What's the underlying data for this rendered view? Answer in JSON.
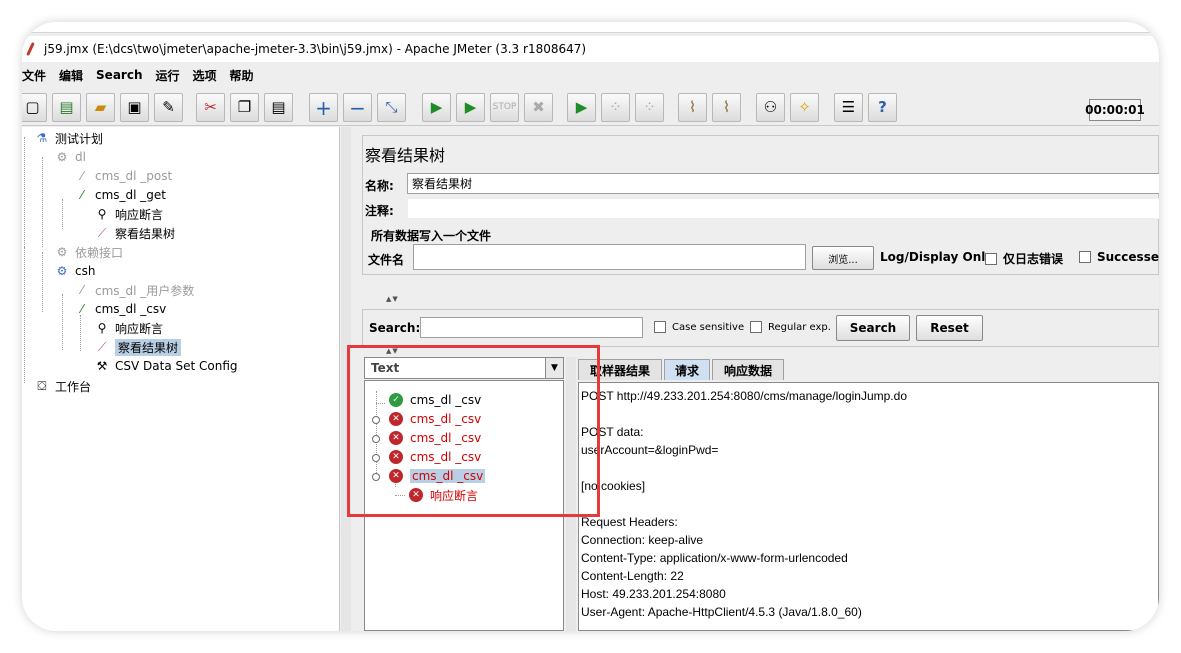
{
  "window": {
    "title": "j59.jmx (E:\\dcs\\two\\jmeter\\apache-jmeter-3.3\\bin\\j59.jmx) - Apache JMeter (3.3 r1808647)"
  },
  "menu": [
    "文件",
    "编辑",
    "Search",
    "运行",
    "选项",
    "帮助"
  ],
  "toolbar": {
    "timer": "00:00:01",
    "buttons": [
      "new-icon",
      "templates-icon",
      "open-icon",
      "save-icon",
      "save-as-icon",
      "cut-icon",
      "copy-icon",
      "paste-icon",
      "expand-icon",
      "collapse-icon",
      "toggle-icon",
      "start-icon",
      "start-no-pause-icon",
      "stop-icon",
      "shutdown-icon",
      "remote-start-icon",
      "remote-stop-icon",
      "remote-shutdown-icon",
      "clear-icon",
      "clear-all-icon",
      "search-icon",
      "reset-search-icon",
      "function-helper-icon",
      "help-icon"
    ]
  },
  "test_tree": [
    {
      "label": "测试计划",
      "icon": "flask-icon",
      "dim": false
    },
    {
      "label": "dl",
      "icon": "gear-icon",
      "dim": true
    },
    {
      "label": "cms_dl _post",
      "icon": "pipette-icon",
      "dim": true
    },
    {
      "label": "cms_dl _get",
      "icon": "pipette-icon",
      "dim": false
    },
    {
      "label": "响应断言",
      "icon": "magnifier-icon",
      "dim": false
    },
    {
      "label": "察看结果树",
      "icon": "chart-icon",
      "dim": false
    },
    {
      "label": "依赖接口",
      "icon": "gear-icon",
      "dim": true
    },
    {
      "label": "csh",
      "icon": "gear-icon",
      "dim": false
    },
    {
      "label": "cms_dl _用户参数",
      "icon": "pipette-icon",
      "dim": true
    },
    {
      "label": "cms_dl _csv",
      "icon": "pipette-icon",
      "dim": false
    },
    {
      "label": "响应断言",
      "icon": "magnifier-icon",
      "dim": false
    },
    {
      "label": "察看结果树",
      "icon": "chart-icon",
      "dim": false,
      "selected": true
    },
    {
      "label": "CSV Data Set Config",
      "icon": "tools-icon",
      "dim": false
    },
    {
      "label": "工作台",
      "icon": "workbench-icon",
      "dim": false
    }
  ],
  "panel": {
    "title": "察看结果树",
    "name_label": "名称:",
    "name_value": "察看结果树",
    "comment_label": "注释:",
    "write_all_label": "所有数据写入一个文件",
    "filename_label": "文件名",
    "filename_value": "",
    "browse_label": "浏览...",
    "log_display_label": "Log/Display Only:",
    "errors_only_label": "仅日志错误",
    "successes_label": "Successes"
  },
  "search": {
    "label": "Search:",
    "value": "",
    "case_sensitive": "Case sensitive",
    "regular_exp": "Regular exp.",
    "search_button": "Search",
    "reset_button": "Reset"
  },
  "renderer": {
    "selected": "Text"
  },
  "results": [
    {
      "label": "cms_dl _csv",
      "status": "ok"
    },
    {
      "label": "cms_dl _csv",
      "status": "fail"
    },
    {
      "label": "cms_dl _csv",
      "status": "fail"
    },
    {
      "label": "cms_dl _csv",
      "status": "fail"
    },
    {
      "label": "cms_dl _csv",
      "status": "fail",
      "selected": true
    },
    {
      "label": "响应断言",
      "status": "fail",
      "child": true
    }
  ],
  "tabs": [
    "取样器结果",
    "请求",
    "响应数据"
  ],
  "active_tab": 1,
  "request_text": [
    "POST http://49.233.201.254:8080/cms/manage/loginJump.do",
    "",
    "POST data:",
    "userAccount=&loginPwd=",
    "",
    "[no cookies]",
    "",
    "Request Headers:",
    "Connection: keep-alive",
    "Content-Type: application/x-www-form-urlencoded",
    "Content-Length: 22",
    "Host: 49.233.201.254:8080",
    "User-Agent: Apache-HttpClient/4.5.3 (Java/1.8.0_60)"
  ],
  "colors": {
    "highlight_box": "#e8393a",
    "fail_text": "#d40000",
    "ok_icon": "#2e9b40",
    "fail_icon": "#c0272d",
    "selection": "#b8cfe5"
  }
}
